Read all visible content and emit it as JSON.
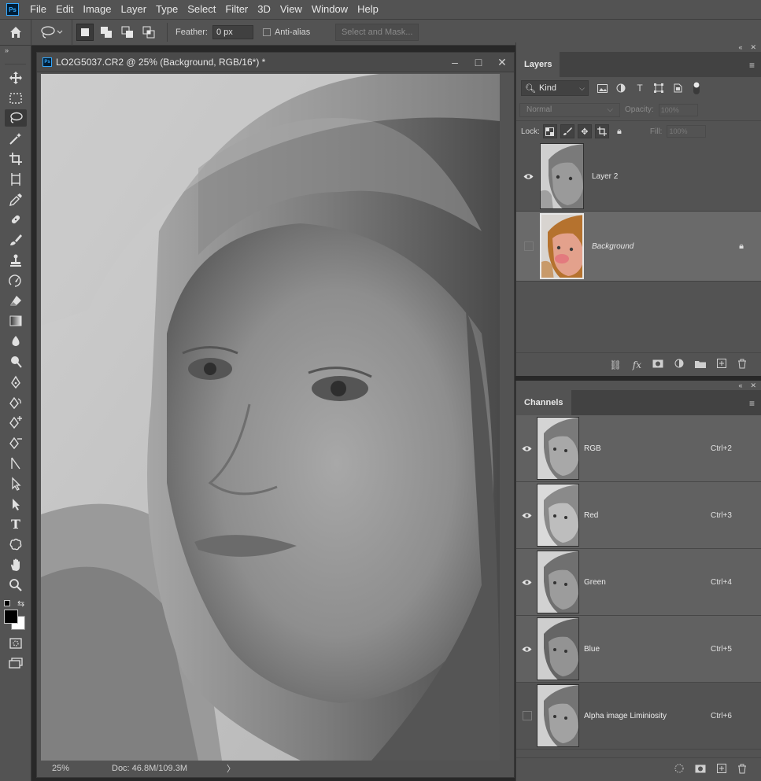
{
  "app": {
    "logo": "Ps"
  },
  "menu": [
    "File",
    "Edit",
    "Image",
    "Layer",
    "Type",
    "Select",
    "Filter",
    "3D",
    "View",
    "Window",
    "Help"
  ],
  "options": {
    "feather_label": "Feather:",
    "feather_value": "0 px",
    "antialias_label": "Anti-alias",
    "select_mask_label": "Select and Mask..."
  },
  "document": {
    "title": "LO2G5037.CR2 @ 25% (Background, RGB/16*) *",
    "zoom": "25%",
    "doc_size": "Doc: 46.8M/109.3M",
    "status_arrow": "〉"
  },
  "layers_panel": {
    "tab": "Layers",
    "kind_label": "Kind",
    "blend_mode": "Normal",
    "opacity_label": "Opacity:",
    "opacity_value": "100%",
    "lock_label": "Lock:",
    "fill_label": "Fill:",
    "fill_value": "100%",
    "layers": [
      {
        "name": "Layer 2",
        "visible": true,
        "selected": false,
        "locked": false
      },
      {
        "name": "Background",
        "visible": false,
        "selected": true,
        "locked": true
      }
    ]
  },
  "channels_panel": {
    "tab": "Channels",
    "channels": [
      {
        "name": "RGB",
        "shortcut": "Ctrl+2",
        "visible": true
      },
      {
        "name": "Red",
        "shortcut": "Ctrl+3",
        "visible": true
      },
      {
        "name": "Green",
        "shortcut": "Ctrl+4",
        "visible": true
      },
      {
        "name": "Blue",
        "shortcut": "Ctrl+5",
        "visible": true
      },
      {
        "name": "Alpha image Liminiosity",
        "shortcut": "Ctrl+6",
        "visible": false
      }
    ]
  },
  "colors": {
    "foreground": "#000000",
    "background": "#ffffff",
    "ps_blue": "#31a8ff"
  }
}
